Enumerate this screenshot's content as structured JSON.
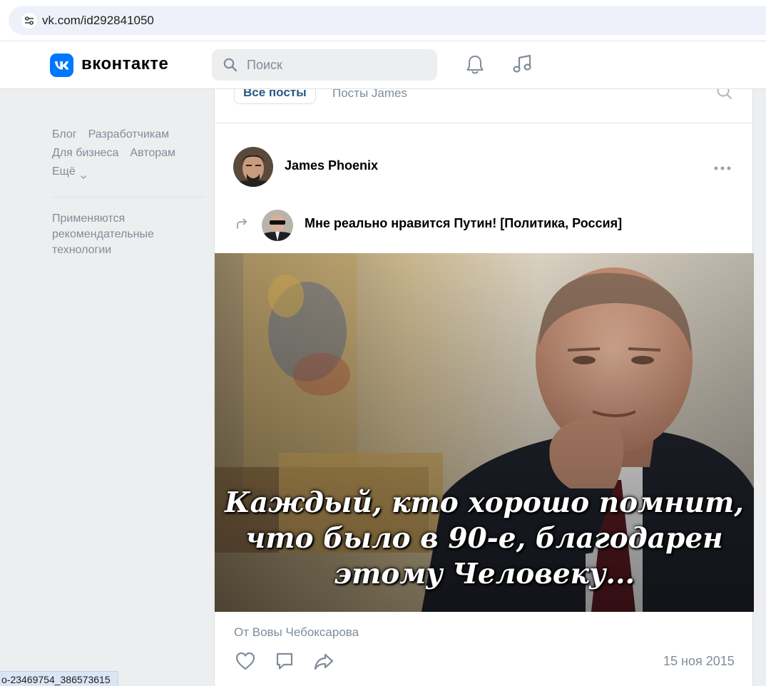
{
  "browser": {
    "url": "vk.com/id292841050",
    "site_info_icon": "tune-icon"
  },
  "header": {
    "brand": "вконтакте",
    "search_placeholder": "Поиск",
    "icons": [
      "vk-logo-icon",
      "search-icon",
      "bell-icon",
      "music-icon"
    ],
    "accent_color": "#0077ff"
  },
  "sidebar": {
    "links": [
      "Блог",
      "Разработчикам",
      "Для бизнеса",
      "Авторам",
      "Ещё"
    ],
    "recommendation_note": "Применяются рекомендательные технологии"
  },
  "tabs": {
    "all_posts": "Все посты",
    "user_posts": "Посты James"
  },
  "post": {
    "author": "James Phoenix",
    "repost_title": "Мне реально нравится Путин! [Политика, Россия]",
    "image_caption": "Каждый, кто хорошо помнит, что было в 90-е, благодарен этому Человеку...",
    "from": "От Вовы Чебоксарова",
    "date": "15 ноя 2015"
  },
  "status_bar": {
    "link_preview": "o-23469754_386573615"
  }
}
